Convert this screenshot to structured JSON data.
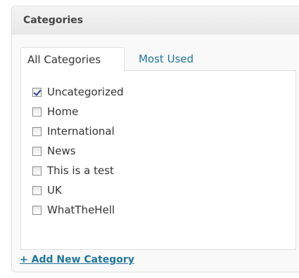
{
  "panel": {
    "title": "Categories"
  },
  "tabs": [
    {
      "label": "All Categories",
      "active": true
    },
    {
      "label": "Most Used",
      "active": false
    }
  ],
  "categories": [
    {
      "label": "Uncategorized",
      "checked": true
    },
    {
      "label": "Home",
      "checked": false
    },
    {
      "label": "International",
      "checked": false
    },
    {
      "label": "News",
      "checked": false
    },
    {
      "label": "This is a test",
      "checked": false
    },
    {
      "label": "UK",
      "checked": false
    },
    {
      "label": "WhatTheHell",
      "checked": false
    }
  ],
  "add_category": {
    "label": "+ Add New Category"
  },
  "colors": {
    "link": "#21759b",
    "text": "#333333",
    "border": "#dfdfdf",
    "panel_bg": "#f9f9f9"
  }
}
